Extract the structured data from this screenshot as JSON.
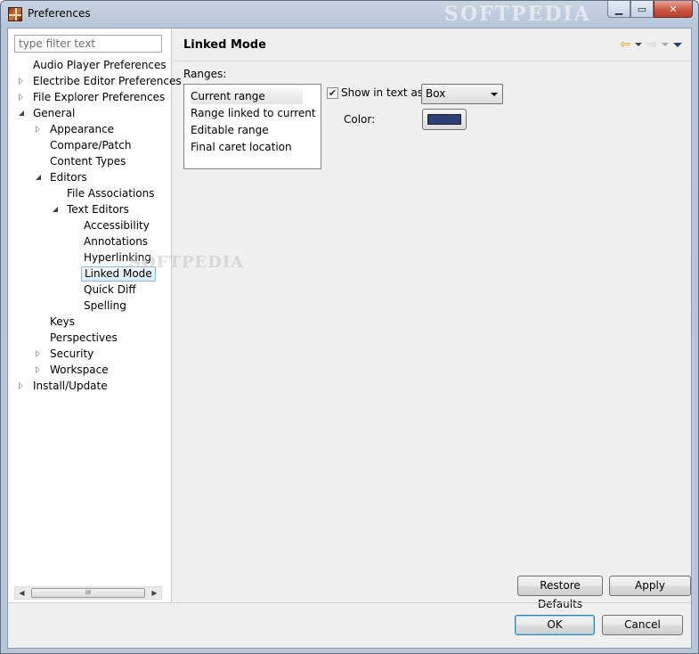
{
  "window": {
    "title": "Preferences",
    "watermark": "SOFTPEDIA"
  },
  "filter": {
    "placeholder": "type filter text"
  },
  "tree": [
    {
      "label": "Audio Player Preferences",
      "twisty": "none",
      "level": 0
    },
    {
      "label": "Electribe Editor Preferences",
      "twisty": "collapsed",
      "level": 0
    },
    {
      "label": "File Explorer Preferences",
      "twisty": "collapsed",
      "level": 0
    },
    {
      "label": "General",
      "twisty": "expanded",
      "level": 0
    },
    {
      "label": "Appearance",
      "twisty": "collapsed",
      "level": 1
    },
    {
      "label": "Compare/Patch",
      "twisty": "none",
      "level": 1
    },
    {
      "label": "Content Types",
      "twisty": "none",
      "level": 1
    },
    {
      "label": "Editors",
      "twisty": "expanded",
      "level": 1
    },
    {
      "label": "File Associations",
      "twisty": "none",
      "level": 2
    },
    {
      "label": "Text Editors",
      "twisty": "expanded",
      "level": 2
    },
    {
      "label": "Accessibility",
      "twisty": "none",
      "level": 3
    },
    {
      "label": "Annotations",
      "twisty": "none",
      "level": 3
    },
    {
      "label": "Hyperlinking",
      "twisty": "none",
      "level": 3
    },
    {
      "label": "Linked Mode",
      "twisty": "none",
      "level": 3,
      "selected": true
    },
    {
      "label": "Quick Diff",
      "twisty": "none",
      "level": 3
    },
    {
      "label": "Spelling",
      "twisty": "none",
      "level": 3
    },
    {
      "label": "Keys",
      "twisty": "none",
      "level": 1
    },
    {
      "label": "Perspectives",
      "twisty": "none",
      "level": 1
    },
    {
      "label": "Security",
      "twisty": "collapsed",
      "level": 1
    },
    {
      "label": "Workspace",
      "twisty": "collapsed",
      "level": 1
    },
    {
      "label": "Install/Update",
      "twisty": "collapsed",
      "level": 0
    }
  ],
  "scrollbar": {
    "thumb_grip": "III"
  },
  "page": {
    "title": "Linked Mode",
    "ranges_label": "Ranges:",
    "ranges": [
      "Current range",
      "Range linked to current",
      "Editable range",
      "Final caret location"
    ],
    "selected_range": "Current range",
    "show_in_text_label": "Show in text as:",
    "show_in_text_checked": true,
    "show_in_text_value": "Box",
    "color_label": "Color:",
    "color_value": "#2f3f78",
    "restore_defaults": "Restore Defaults",
    "apply": "Apply"
  },
  "dialog": {
    "ok": "OK",
    "cancel": "Cancel"
  },
  "colors": {
    "selection_border": "#85b8e4",
    "default_button_border": "#3c7fb1"
  }
}
